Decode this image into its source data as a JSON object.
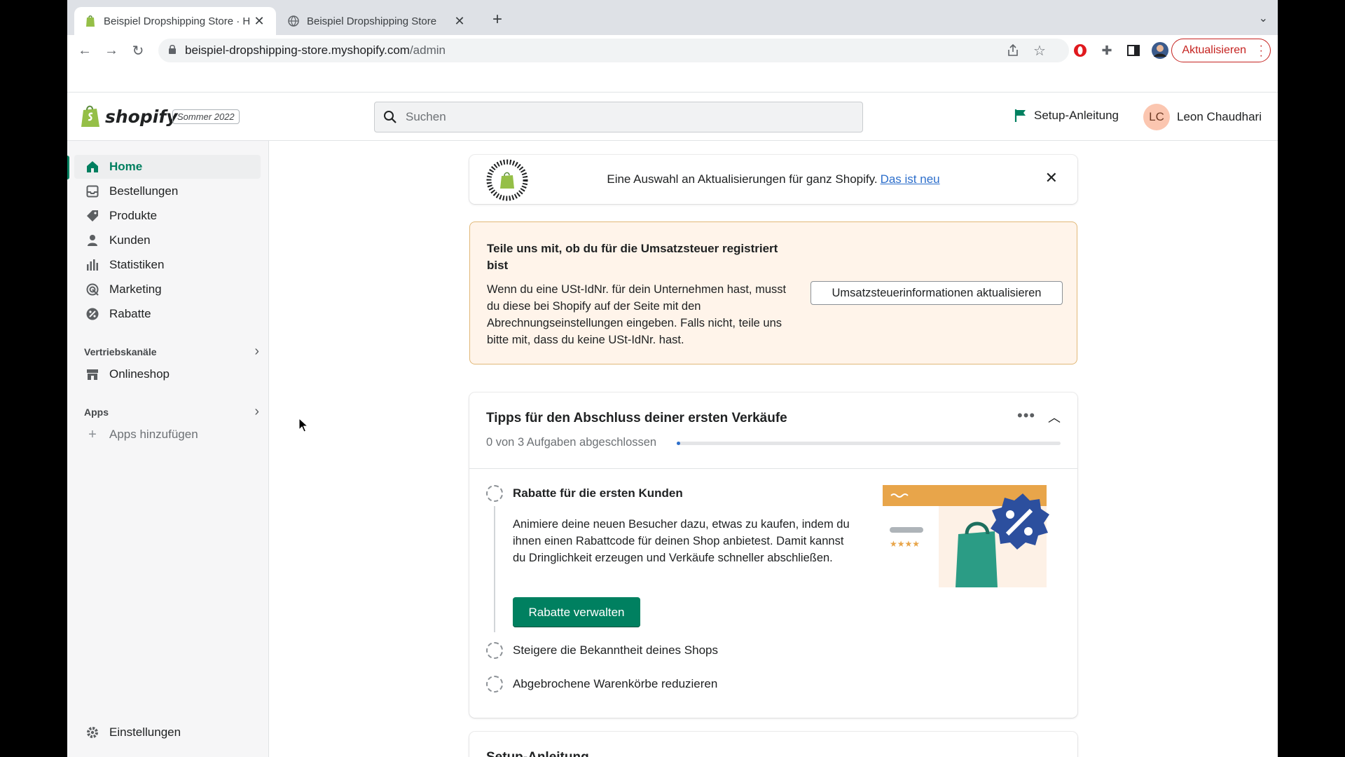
{
  "browser": {
    "tabs": [
      {
        "title": "Beispiel Dropshipping Store · H",
        "active": true
      },
      {
        "title": "Beispiel Dropshipping Store",
        "active": false
      }
    ],
    "url_host": "beispiel-dropshipping-store.myshopify.com",
    "url_path": "/admin",
    "update_label": "Aktualisieren"
  },
  "topbar": {
    "logo_text": "shopify",
    "edition_badge": "Sommer 2022",
    "search_placeholder": "Suchen",
    "setup_link": "Setup-Anleitung",
    "avatar_initials": "LC",
    "user_name": "Leon Chaudhari"
  },
  "sidebar": {
    "items": [
      {
        "label": "Home",
        "icon": "home-icon",
        "active": true
      },
      {
        "label": "Bestellungen",
        "icon": "orders-icon"
      },
      {
        "label": "Produkte",
        "icon": "tag-icon"
      },
      {
        "label": "Kunden",
        "icon": "person-icon"
      },
      {
        "label": "Statistiken",
        "icon": "bar-chart-icon"
      },
      {
        "label": "Marketing",
        "icon": "target-icon"
      },
      {
        "label": "Rabatte",
        "icon": "discount-icon"
      }
    ],
    "sales_channels_heading": "Vertriebskanäle",
    "online_store": "Onlineshop",
    "apps_heading": "Apps",
    "add_apps": "Apps hinzufügen",
    "settings": "Einstellungen"
  },
  "edition_banner": {
    "text": "Eine Auswahl an Aktualisierungen für ganz Shopify.",
    "link": "Das ist neu"
  },
  "tax_banner": {
    "title": "Teile uns mit, ob du für die Umsatzsteuer registriert bist",
    "body": "Wenn du eine USt-IdNr. für dein Unternehmen hast, musst du diese bei Shopify auf der Seite mit den Abrechnungseinstellungen eingeben. Falls nicht, teile uns bitte mit, dass du keine USt-IdNr. hast.",
    "button": "Umsatzsteuerinformationen aktualisieren"
  },
  "tips": {
    "title": "Tipps für den Abschluss deiner ersten Verkäufe",
    "progress_text": "0 von 3 Aufgaben abgeschlossen",
    "progress_fraction": 0,
    "tasks": [
      {
        "label": "Rabatte für die ersten Kunden",
        "expanded": true,
        "description": "Animiere deine neuen Besucher dazu, etwas zu kaufen, indem du ihnen einen Rabattcode für deinen Shop anbietest. Damit kannst du Dringlichkeit erzeugen und Verkäufe schneller abschließen.",
        "button": "Rabatte verwalten"
      },
      {
        "label": "Steigere die Bekanntheit deines Shops"
      },
      {
        "label": "Abgebrochene Warenkörbe reduzieren"
      }
    ]
  },
  "setup_card": {
    "title": "Setup-Anleitung"
  },
  "colors": {
    "brand_green": "#008060",
    "link_blue": "#2c6ecb",
    "warning_bg": "#fff4ea"
  }
}
